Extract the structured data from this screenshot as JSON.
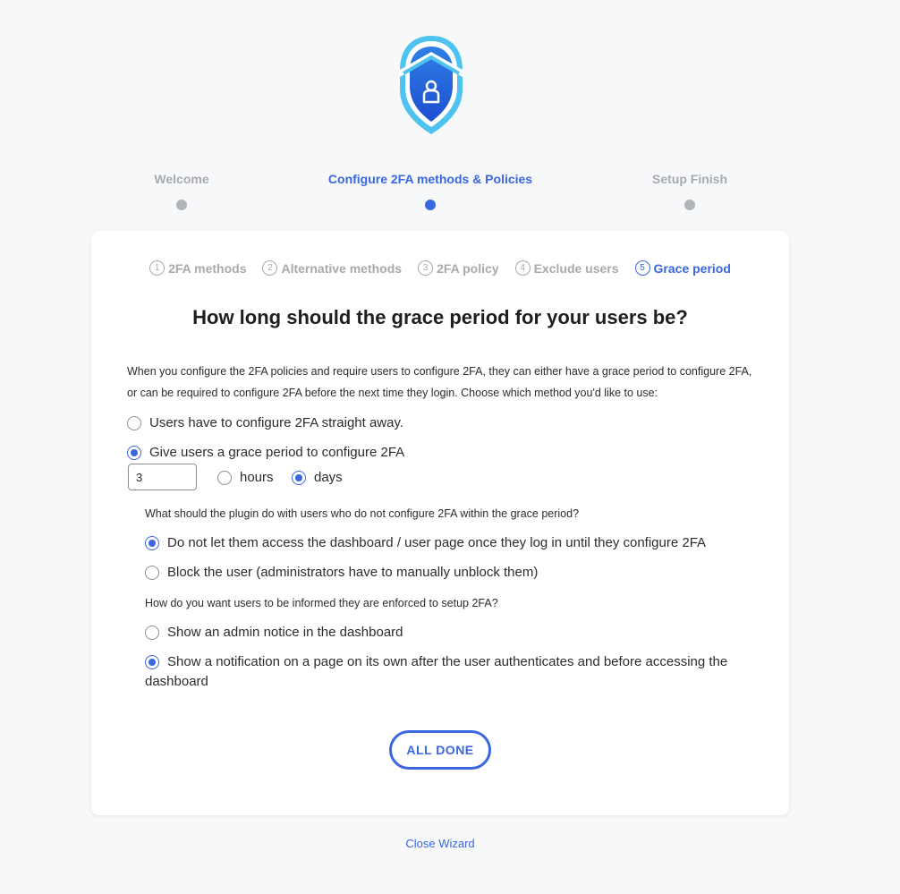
{
  "wizard": {
    "steps": [
      {
        "label": "Welcome",
        "active": false
      },
      {
        "label": "Configure 2FA methods & Policies",
        "active": true
      },
      {
        "label": "Setup Finish",
        "active": false
      }
    ],
    "substeps": [
      {
        "num": "1",
        "label": "2FA methods",
        "active": false
      },
      {
        "num": "2",
        "label": "Alternative methods",
        "active": false
      },
      {
        "num": "3",
        "label": "2FA policy",
        "active": false
      },
      {
        "num": "4",
        "label": "Exclude users",
        "active": false
      },
      {
        "num": "5",
        "label": "Grace period",
        "active": true
      }
    ],
    "heading": "How long should the grace period for your users be?",
    "description": "When you configure the 2FA policies and require users to configure 2FA, they can either have a grace period to configure 2FA, or can be required to configure 2FA before the next time they login. Choose which method you'd like to use:",
    "options": {
      "straight_away": "Users have to configure 2FA straight away.",
      "grace_period": "Give users a grace period to configure 2FA"
    },
    "grace": {
      "value": "3",
      "hours": "hours",
      "days": "days"
    },
    "q1": {
      "question": "What should the plugin do with users who do not configure 2FA within the grace period?",
      "opt1": "Do not let them access the dashboard / user page once they log in until they configure 2FA",
      "opt2": "Block the user (administrators have to manually unblock them)"
    },
    "q2": {
      "question": "How do you want users to be informed they are enforced to setup 2FA?",
      "opt1": "Show an admin notice in the dashboard",
      "opt2": "Show a notification on a page on its own after the user authenticates and before accessing the dashboard"
    },
    "done_label": "ALL DONE",
    "close_label": "Close Wizard"
  },
  "colors": {
    "accent": "#3a66e0",
    "muted": "#a7aaad",
    "shield_light": "#4fc3ef",
    "shield_dark": "#1f5fd8"
  }
}
